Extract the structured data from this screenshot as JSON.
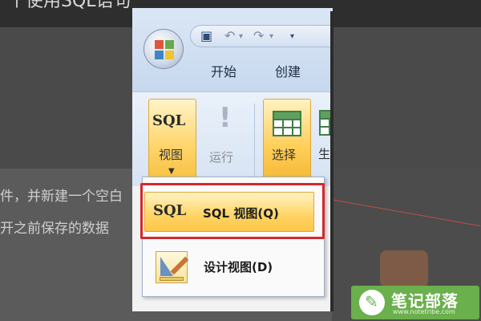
{
  "background": {
    "title_fragment": "个使用SQL语句",
    "line1": "件，并新建一个空白",
    "line2": "开之前保存的数据"
  },
  "quick_access": {
    "save_icon": "floppy-disk-icon",
    "undo_icon": "undo-arrow-icon",
    "redo_icon": "redo-arrow-icon"
  },
  "tabs": [
    {
      "label": "开始"
    },
    {
      "label": "创建"
    }
  ],
  "ribbon": {
    "view_button": {
      "icon_text": "SQL",
      "label": "视图"
    },
    "run_button": {
      "label": "运行"
    },
    "select_button": {
      "label": "选择"
    },
    "generate_button": {
      "label": "生"
    }
  },
  "dropdown": {
    "items": [
      {
        "icon_text": "SQL",
        "label": "SQL 视图(Q)",
        "highlighted": true
      },
      {
        "icon": "design-view-icon",
        "label": "设计视图(D)"
      }
    ]
  },
  "watermark": {
    "title": "笔记部落",
    "url": "www.notetribe.com"
  },
  "colors": {
    "ribbon_blue": "#c7d8ee",
    "button_orange": "#ffd56b",
    "highlight_red": "#d4282b",
    "watermark_green": "#6ab04c"
  }
}
